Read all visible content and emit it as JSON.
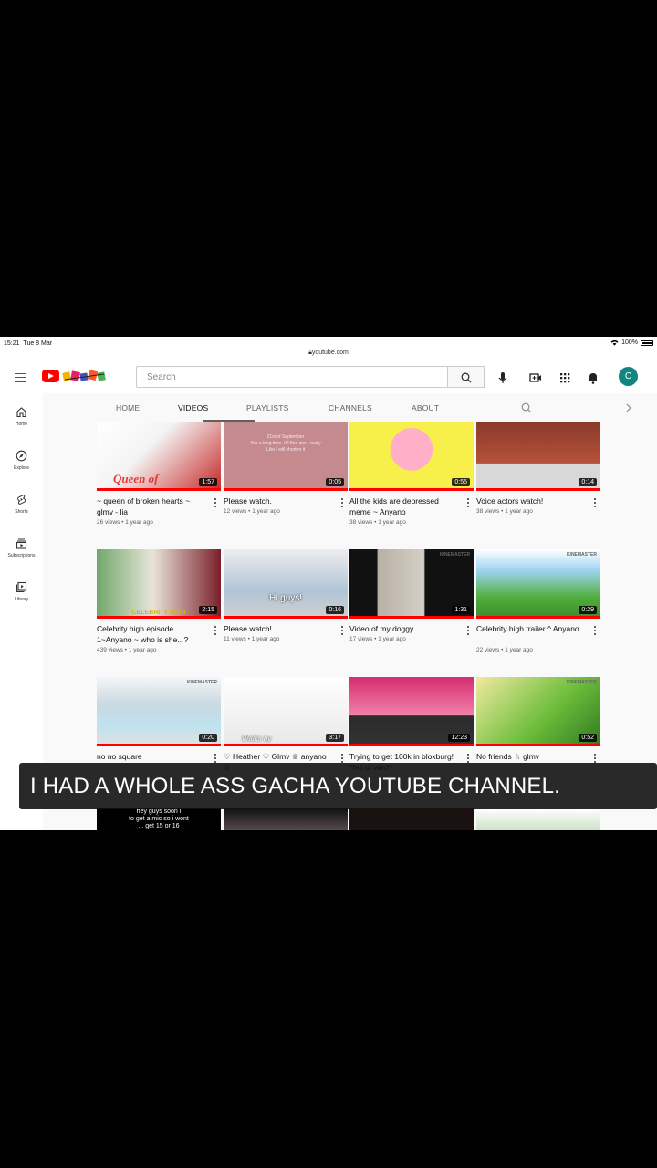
{
  "status": {
    "time": "15:21",
    "date": "Tue 8 Mar",
    "battery": "100%"
  },
  "url": "youtube.com",
  "search": {
    "placeholder": "Search"
  },
  "avatar_letter": "C",
  "sidebar": [
    {
      "label": "Home",
      "icon": "home-icon"
    },
    {
      "label": "Explore",
      "icon": "compass-icon"
    },
    {
      "label": "Shorts",
      "icon": "shorts-icon"
    },
    {
      "label": "Subscriptions",
      "icon": "subscriptions-icon"
    },
    {
      "label": "Library",
      "icon": "library-icon"
    }
  ],
  "tabs": [
    "HOME",
    "VIDEOS",
    "PLAYLISTS",
    "CHANNELS",
    "ABOUT"
  ],
  "active_tab": "VIDEOS",
  "videos": [
    {
      "title": "~ queen of broken hearts ~ glmv - lia",
      "views": "26 views",
      "age": "1 year ago",
      "duration": "1:57",
      "thumb_text": "Queen of"
    },
    {
      "title": "Please watch.",
      "views": "12 views",
      "age": "1 year ago",
      "duration": "0:05",
      "thumb_text": "21st of September\nYes a long time. If I find one i really\nLike I will shorten it"
    },
    {
      "title": "All the kids are depressed meme ~ Anyano",
      "views": "38 views",
      "age": "1 year ago",
      "duration": "0:55",
      "thumb_text": ""
    },
    {
      "title": "Voice actors watch!",
      "views": "38 views",
      "age": "1 year ago",
      "duration": "0:14",
      "thumb_text": ""
    },
    {
      "title": "Celebrity high episode 1~Anyano ~ who is she.. ?",
      "views": "439 views",
      "age": "1 year ago",
      "duration": "2:15",
      "thumb_text": "CELEBRITY HIGH"
    },
    {
      "title": "Please watch!",
      "views": "11 views",
      "age": "1 year ago",
      "duration": "0:16",
      "thumb_text": "Hi guys!"
    },
    {
      "title": "Video of my doggy",
      "views": "17 views",
      "age": "1 year ago",
      "duration": "1:31",
      "thumb_text": "KINEMASTER"
    },
    {
      "title": "Celebrity high trailer ^ Anyano",
      "views": "22 views",
      "age": "1 year ago",
      "duration": "0:29",
      "thumb_text": "KINEMASTER"
    },
    {
      "title": "no no square",
      "views": "",
      "age": "",
      "duration": "0:20",
      "thumb_text": "KINEMASTER"
    },
    {
      "title": "♡ Heather ♡ Glmv ♕ anyano ♕",
      "views": "",
      "age": "",
      "duration": "3:17",
      "thumb_text": "Walks by"
    },
    {
      "title": "Trying to get 100k in bloxburg! *fail or win?*",
      "views": "",
      "age": "",
      "duration": "12:23",
      "thumb_text": ""
    },
    {
      "title": "No friends ☆ glmv",
      "views": "",
      "age": "",
      "duration": "0:52",
      "thumb_text": "KINEMASTER"
    },
    {
      "title": "",
      "views": "",
      "age": "",
      "duration": "",
      "thumb_text": "hey guys soon i\nto get a mic so i wont\n... get 15 or 16"
    },
    {
      "title": "",
      "views": "",
      "age": "",
      "duration": "",
      "thumb_text": ""
    },
    {
      "title": "",
      "views": "",
      "age": "",
      "duration": "",
      "thumb_text": ""
    },
    {
      "title": "",
      "views": "",
      "age": "",
      "duration": "",
      "thumb_text": ""
    }
  ],
  "caption": "I HAD A WHOLE ASS GACHA YOUTUBE CHANNEL.",
  "colors": {
    "brand_red": "#ff0000",
    "avatar_bg": "#12857f",
    "caption_bg": "#121212"
  }
}
